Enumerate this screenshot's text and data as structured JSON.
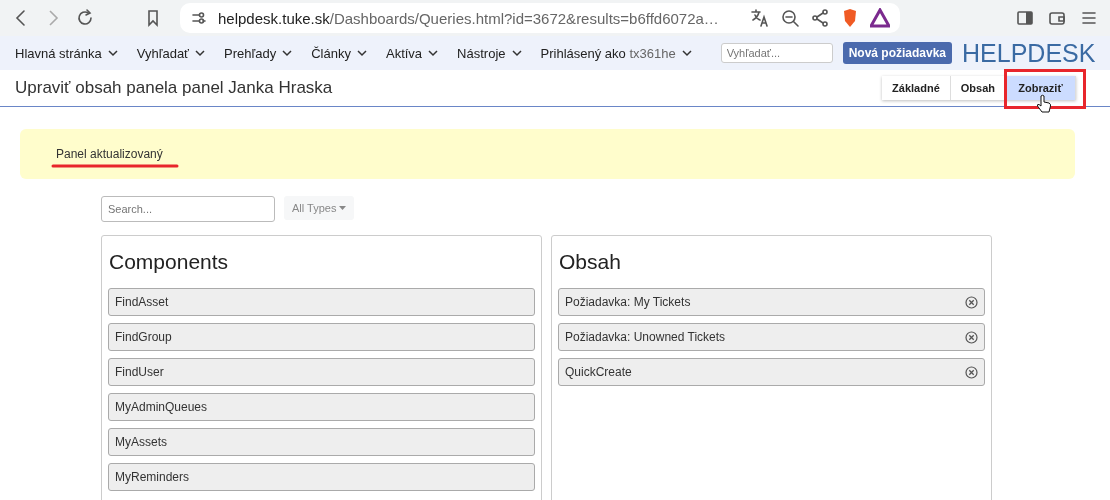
{
  "browser": {
    "url_host": "helpdesk.tuke.sk",
    "url_path": "/Dashboards/Queries.html?id=3672&results=b6ffd6072a…"
  },
  "nav": {
    "items": [
      {
        "label": "Hlavná stránka"
      },
      {
        "label": "Vyhľadať"
      },
      {
        "label": "Prehľady"
      },
      {
        "label": "Články"
      },
      {
        "label": "Aktíva"
      },
      {
        "label": "Nástroje"
      }
    ],
    "user_label": "Prihlásený ako",
    "user_name": "tx361he",
    "search": {
      "placeholder": "Vyhľadať..."
    },
    "new_button": "Nová požiadavka",
    "logo": "HELPDESK"
  },
  "page_title": "Upraviť obsah panela panel Janka Hraska",
  "tabs": [
    {
      "label": "Základné",
      "selected": false
    },
    {
      "label": "Obsah",
      "selected": false
    },
    {
      "label": "Zobraziť",
      "selected": true
    }
  ],
  "alert": "Panel aktualizovaný",
  "filter": {
    "search": {
      "placeholder": "Search..."
    },
    "types": "All Types"
  },
  "components": {
    "title": "Components",
    "items": [
      "FindAsset",
      "FindGroup",
      "FindUser",
      "MyAdminQueues",
      "MyAssets",
      "MyReminders"
    ]
  },
  "content": {
    "title": "Obsah",
    "items": [
      {
        "label": "Požiadavka: My Tickets"
      },
      {
        "label": "Požiadavka: Unowned Tickets"
      },
      {
        "label": "QuickCreate"
      }
    ]
  }
}
